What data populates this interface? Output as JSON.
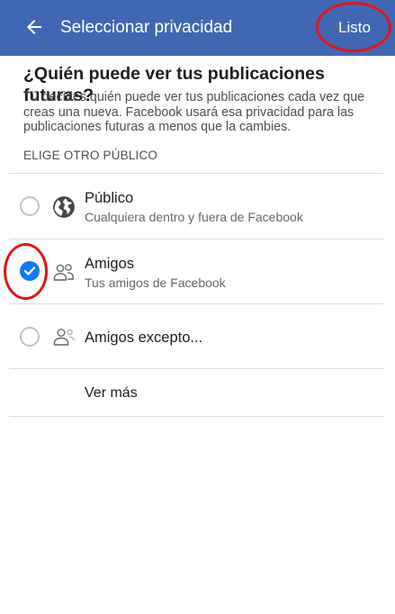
{
  "header": {
    "title": "Seleccionar privacidad",
    "done_label": "Listo",
    "back_icon": "arrow-left-icon",
    "color": "#4267b2"
  },
  "content": {
    "heading": "¿Quién puede ver tus publicaciones futuras?",
    "description": "Tú decides quién puede ver tus publicaciones cada vez que creas una nueva. Facebook usará esa privacidad para las publicaciones futuras a menos que la cambies.",
    "section_label": "ELIGE OTRO PÚBLICO"
  },
  "options": [
    {
      "title": "Público",
      "subtitle": "Cualquiera dentro y fuera de Facebook",
      "icon": "globe-icon",
      "selected": false
    },
    {
      "title": "Amigos",
      "subtitle": "Tus amigos de Facebook",
      "icon": "friends-icon",
      "selected": true
    },
    {
      "title": "Amigos excepto...",
      "subtitle": "",
      "icon": "friends-except-icon",
      "selected": false
    }
  ],
  "see_more_label": "Ver más",
  "accent_color": "#1877f2",
  "annotation_color": "#e0151c"
}
